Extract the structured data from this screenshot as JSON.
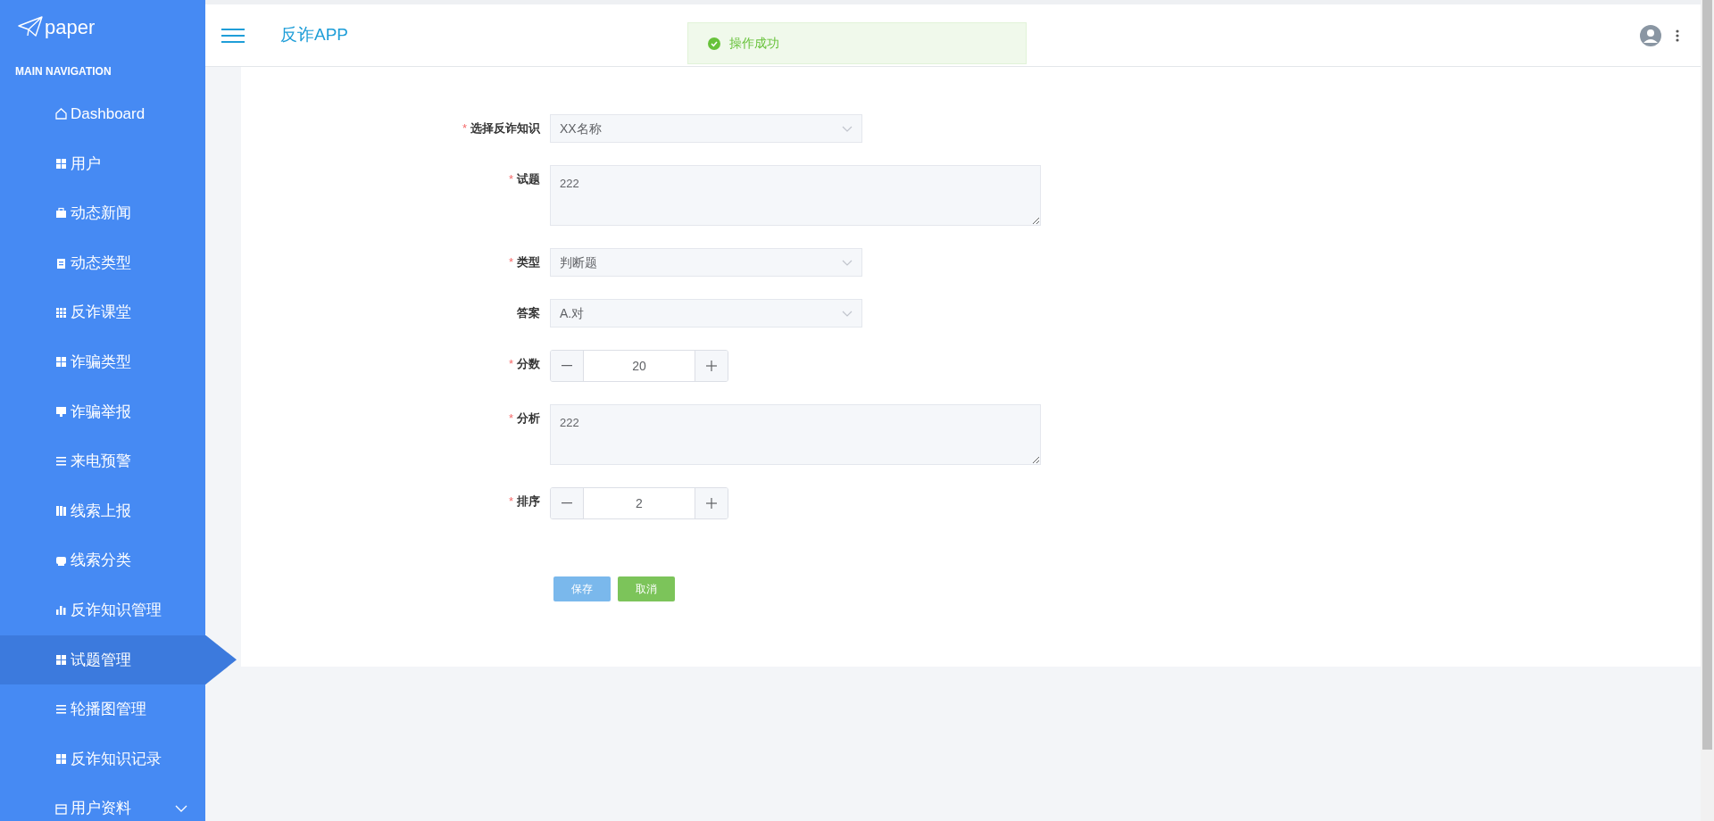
{
  "sidebar": {
    "logo": "paper",
    "section_title": "MAIN NAVIGATION",
    "items": [
      {
        "label": "Dashboard",
        "kind": "home",
        "selected": false
      },
      {
        "label": "用户",
        "kind": "grid",
        "selected": false
      },
      {
        "label": "动态新闻",
        "kind": "briefcase",
        "selected": false
      },
      {
        "label": "动态类型",
        "kind": "clipboard",
        "selected": false
      },
      {
        "label": "反诈课堂",
        "kind": "dots",
        "selected": false
      },
      {
        "label": "诈骗类型",
        "kind": "grid",
        "selected": false
      },
      {
        "label": "诈骗举报",
        "kind": "monitor",
        "selected": false
      },
      {
        "label": "来电预警",
        "kind": "list",
        "selected": false
      },
      {
        "label": "线索上报",
        "kind": "book",
        "selected": false
      },
      {
        "label": "线索分类",
        "kind": "tray",
        "selected": false
      },
      {
        "label": "反诈知识管理",
        "kind": "bars",
        "selected": false
      },
      {
        "label": "试题管理",
        "kind": "grid",
        "selected": true
      },
      {
        "label": "轮播图管理",
        "kind": "list",
        "selected": false
      },
      {
        "label": "反诈知识记录",
        "kind": "grid",
        "selected": false
      },
      {
        "label": "用户资料",
        "kind": "card",
        "selected": false,
        "expanded": false
      }
    ]
  },
  "header": {
    "title": "反诈APP"
  },
  "toast": {
    "message": "操作成功"
  },
  "form": {
    "fields": [
      {
        "required_mark": "*",
        "label": "选择反诈知识",
        "kind": "select",
        "value": "XX名称"
      },
      {
        "required_mark": "*",
        "label": "试题",
        "kind": "textarea",
        "value": "222"
      },
      {
        "required_mark": "*",
        "label": "类型",
        "kind": "select",
        "value": "判断题"
      },
      {
        "label": "答案",
        "kind": "select",
        "value": "A.对"
      },
      {
        "required_mark": "*",
        "label": "分数",
        "kind": "number",
        "value": "20"
      },
      {
        "required_mark": "*",
        "label": "分析",
        "kind": "textarea",
        "value": "222"
      },
      {
        "required_mark": "*",
        "label": "排序",
        "kind": "number",
        "value": "2"
      }
    ],
    "buttons": [
      {
        "label": "保存",
        "kind": "primary"
      },
      {
        "label": "取消",
        "kind": "success"
      }
    ]
  }
}
